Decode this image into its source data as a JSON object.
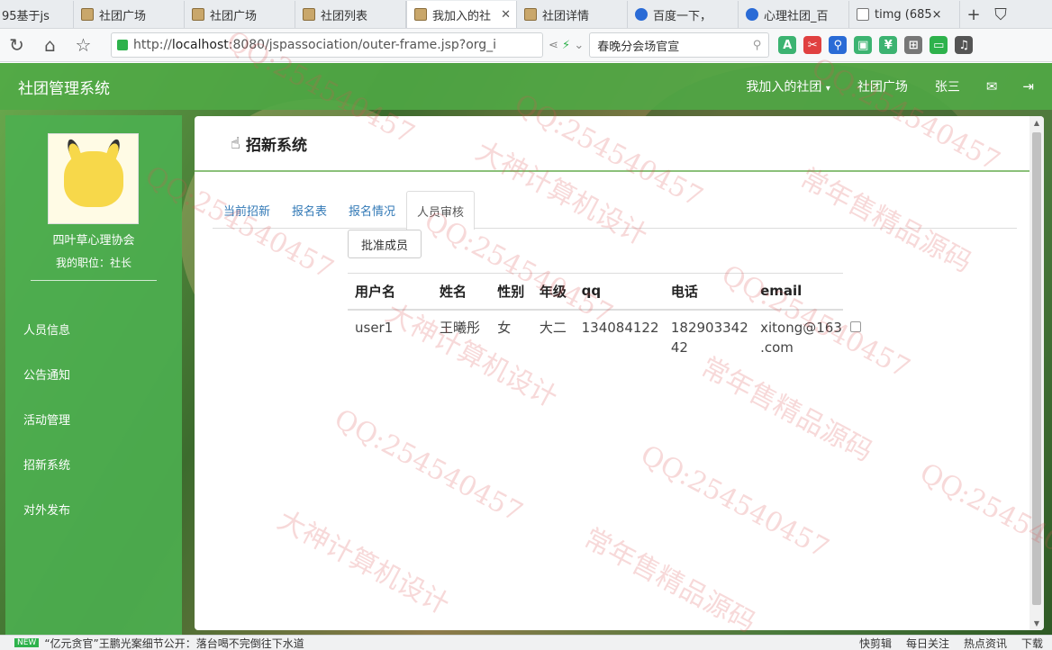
{
  "browser": {
    "tabs": [
      {
        "label": "95基于js",
        "icon": "page-icon"
      },
      {
        "label": "社团广场",
        "icon": "page-icon"
      },
      {
        "label": "社团广场",
        "icon": "page-icon"
      },
      {
        "label": "社团列表",
        "icon": "page-icon"
      },
      {
        "label": "我加入的社",
        "icon": "page-icon",
        "active": true
      },
      {
        "label": "社团详情",
        "icon": "page-icon"
      },
      {
        "label": "百度一下，",
        "icon": "baidu-paw-icon"
      },
      {
        "label": "心理社团_百",
        "icon": "baidu-paw-icon"
      },
      {
        "label": "timg (685×",
        "icon": "document-icon"
      }
    ],
    "url": "http://localhost:8080/jspassociation/outer-frame.jsp?org_i",
    "url_host": "localhost",
    "url_prefix": "http://",
    "url_rest": ":8080/jspassociation/outer-frame.jsp?org_i",
    "search_text": "春晚分会场官宣"
  },
  "app": {
    "brand": "社团管理系统",
    "nav": {
      "my_clubs": "我加入的社团",
      "square": "社团广场",
      "user": "张三"
    },
    "sidebar": {
      "club_name": "四叶草心理协会",
      "position": "我的职位：社长",
      "menu": [
        "人员信息",
        "公告通知",
        "活动管理",
        "招新系统",
        "对外发布"
      ]
    },
    "panel": {
      "title": "招新系统",
      "tabs": [
        "当前招新",
        "报名表",
        "报名情况",
        "人员审核"
      ],
      "active_tab": "人员审核",
      "approve_button": "批准成员",
      "table": {
        "headers": [
          "用户名",
          "姓名",
          "性别",
          "年级",
          "qq",
          "电话",
          "email"
        ],
        "rows": [
          {
            "username": "user1",
            "name": "王曦彤",
            "gender": "女",
            "grade": "大二",
            "qq": "134084122",
            "phone_1": "182903342",
            "phone_2": "42",
            "email_1": "xitong@163",
            "email_2": ".com",
            "checked": false
          }
        ]
      }
    }
  },
  "watermarks": {
    "qq": "QQ:254540457",
    "design": "大神计算机设计",
    "source": "常年售精品源码"
  },
  "statusbar": {
    "badge": "NEW",
    "news": "“亿元贪官”王鹏光案细节公开：落台喝不完倒往下水道",
    "items": [
      "快剪辑",
      "每日关注",
      "热点资讯",
      "下载"
    ]
  }
}
